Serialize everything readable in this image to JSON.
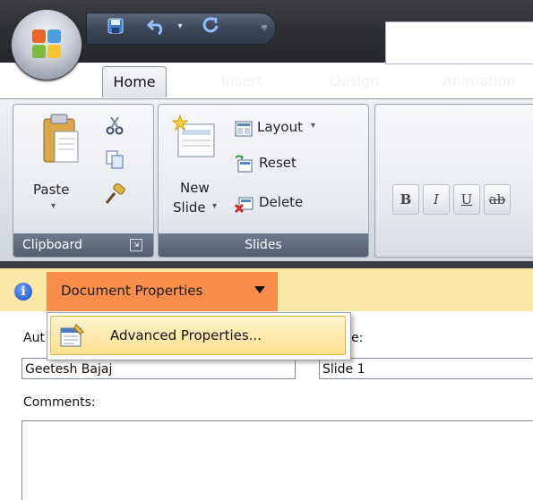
{
  "ribbon": {
    "tabs": [
      {
        "label": "Home",
        "active": true
      },
      {
        "label": "Insert",
        "active": false
      },
      {
        "label": "Design",
        "active": false
      },
      {
        "label": "Animation",
        "active": false
      }
    ],
    "clipboard": {
      "paste_label": "Paste",
      "group_label": "Clipboard"
    },
    "slides": {
      "new_slide_line1": "New",
      "new_slide_line2": "Slide",
      "layout_label": "Layout",
      "reset_label": "Reset",
      "delete_label": "Delete",
      "group_label": "Slides"
    },
    "font": {
      "bold": "B",
      "italic": "I",
      "underline": "U",
      "strike": "ab"
    }
  },
  "document_panel": {
    "button_label": "Document Properties",
    "menu": {
      "item_label": "Advanced Properties..."
    },
    "author_label_partial": "Aut",
    "title_label_partial": "e:",
    "author_value": "Geetesh Bajaj",
    "title_value": "Slide 1",
    "comments_label": "Comments:"
  },
  "colors": {
    "info_bar": "#fde9a5",
    "button_orange": "#f98e4b",
    "menu_highlight": "#ffe08e",
    "ribbon_group_label": "#5e6879"
  },
  "icons": [
    "office-button-icon",
    "save-icon",
    "undo-icon",
    "redo-icon",
    "customize-qat-icon",
    "paste-icon",
    "cut-icon",
    "copy-icon",
    "format-painter-icon",
    "new-slide-icon",
    "layout-icon",
    "reset-icon",
    "delete-icon",
    "dialog-launcher-icon",
    "info-icon",
    "properties-icon"
  ]
}
